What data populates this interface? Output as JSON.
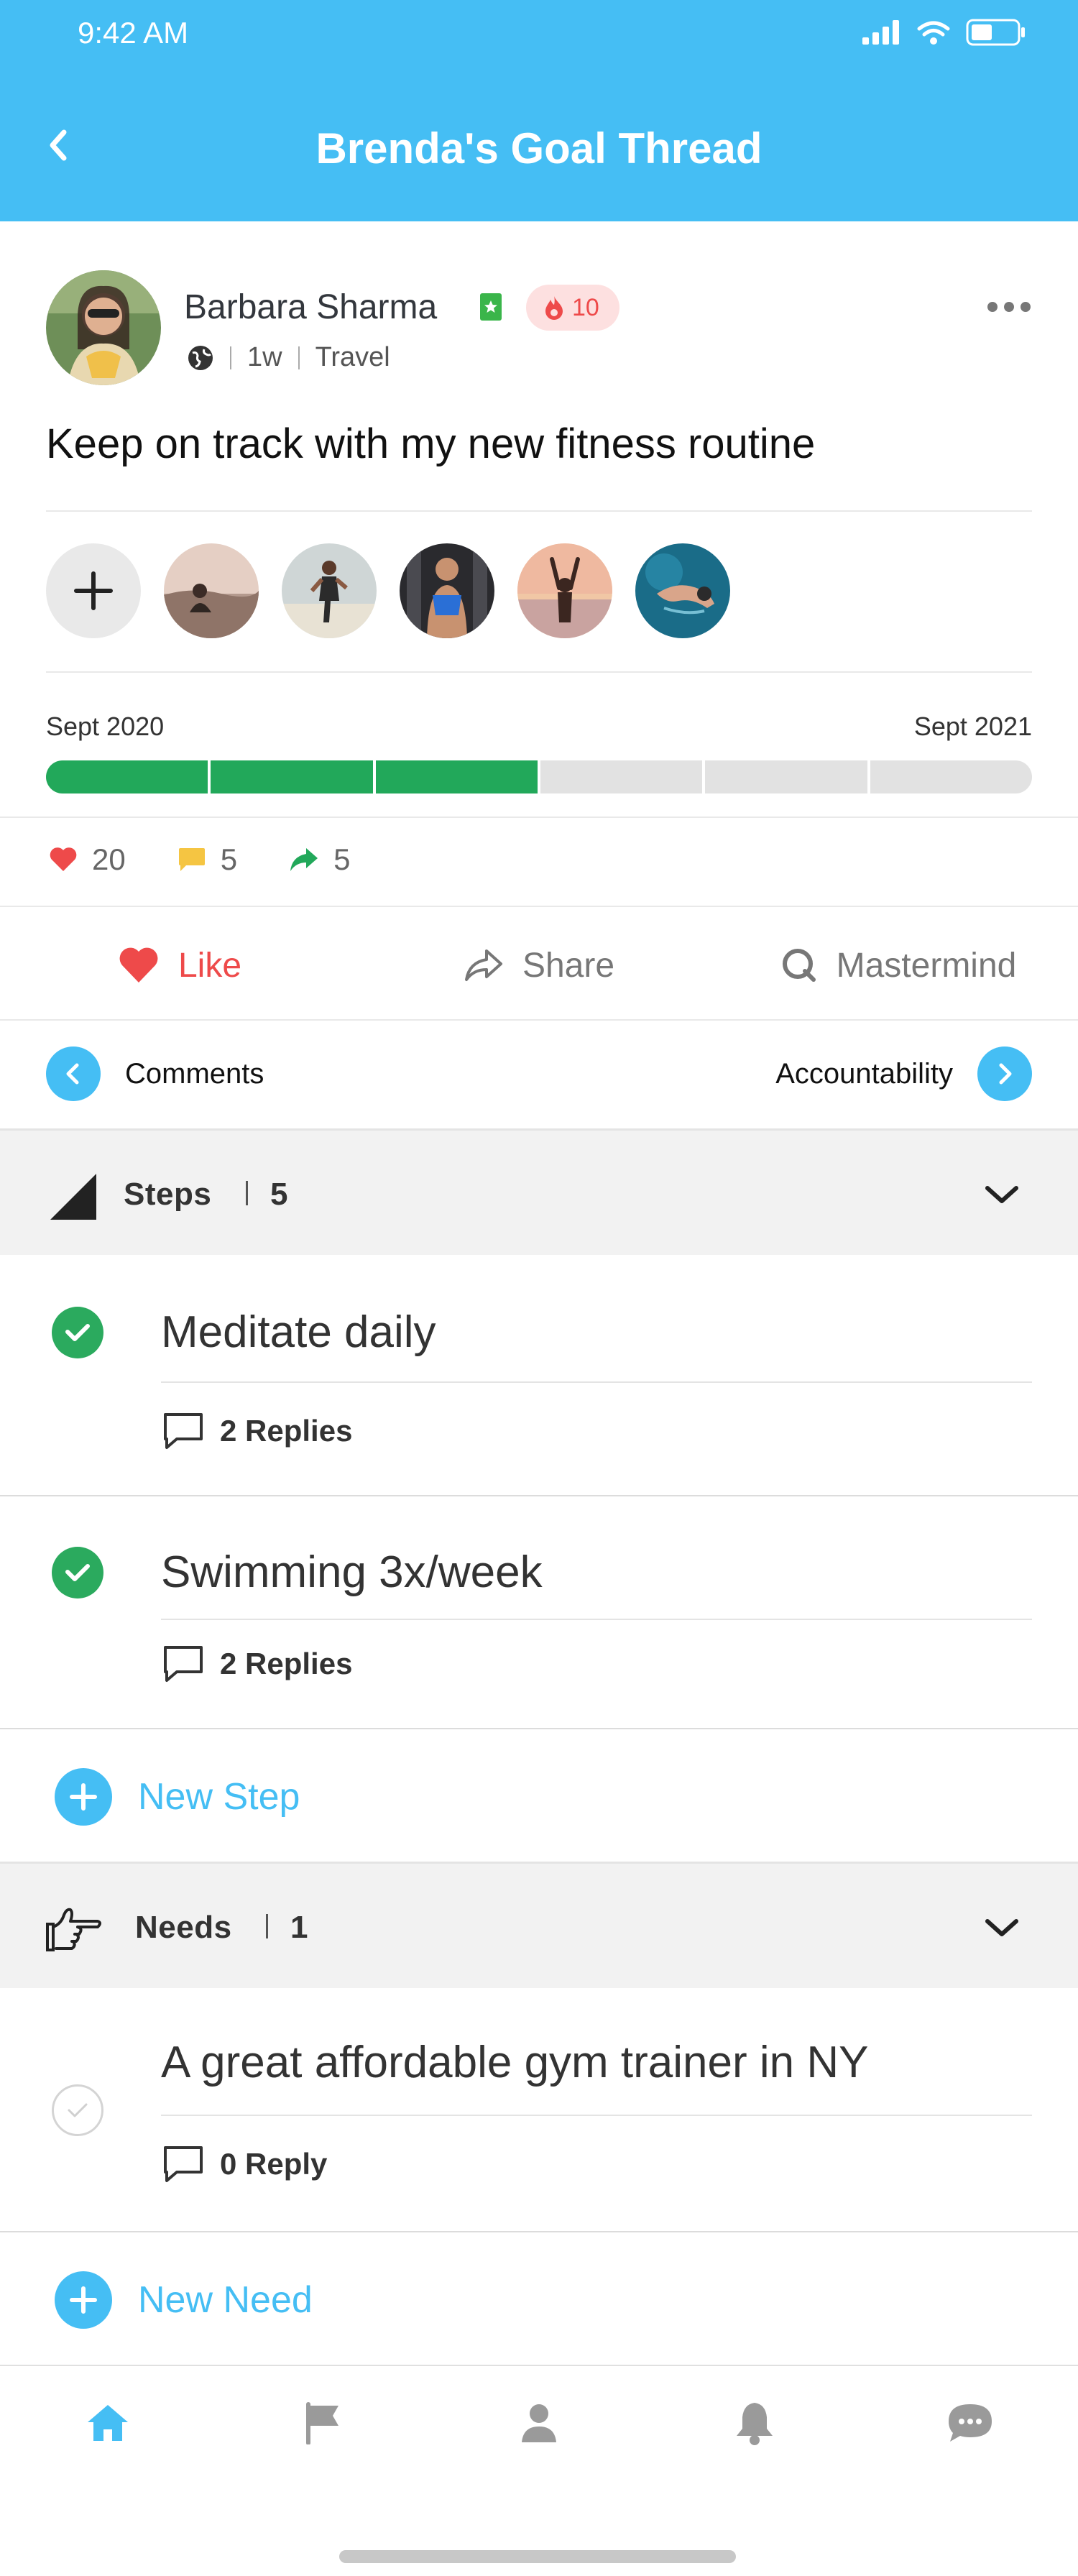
{
  "status_bar": {
    "time": "9:42 AM"
  },
  "header": {
    "title": "Brenda's Goal Thread"
  },
  "post": {
    "author": "Barbara Sharma",
    "fire_count": "10",
    "time_ago": "1w",
    "category": "Travel",
    "goal_title": "Keep on track with my new fitness routine"
  },
  "timeline": {
    "start": "Sept 2020",
    "end": "Sept 2021",
    "segments_total": 6,
    "segments_completed": 3
  },
  "stats": {
    "likes": "20",
    "comments": "5",
    "shares": "5"
  },
  "actions": {
    "like": "Like",
    "share": "Share",
    "mastermind": "Mastermind"
  },
  "switcher": {
    "left": "Comments",
    "right": "Accountability"
  },
  "steps": {
    "label": "Steps",
    "count": "5",
    "items": [
      {
        "title": "Meditate daily",
        "replies": "2 Replies",
        "done": true
      },
      {
        "title": "Swimming 3x/week",
        "replies": "2 Replies",
        "done": true
      }
    ],
    "new_label": "New Step"
  },
  "needs": {
    "label": "Needs",
    "count": "1",
    "items": [
      {
        "title": "A great affordable gym trainer in NY",
        "replies": "0 Reply",
        "done": false
      }
    ],
    "new_label": "New Need"
  },
  "tabbar": {
    "items": [
      "home-icon",
      "flag-icon",
      "profile-icon",
      "bell-icon",
      "chat-icon"
    ],
    "active": "home-icon"
  },
  "colors": {
    "brand": "#45bef4",
    "success": "#22a85a",
    "danger": "#ee4a4a"
  }
}
